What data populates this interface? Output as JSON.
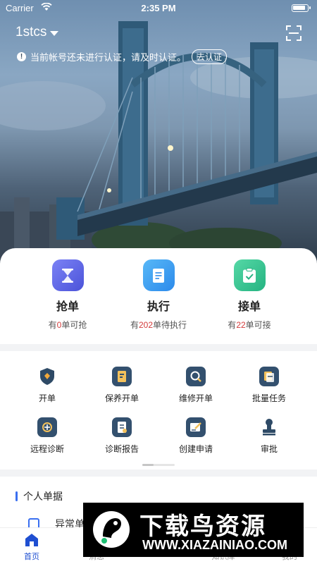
{
  "status_bar": {
    "carrier": "Carrier",
    "time": "2:35 PM"
  },
  "header": {
    "account_name": "1stcs",
    "notice_text": "当前帐号还未进行认证，请及时认证。",
    "notice_action": "去认证"
  },
  "quick_actions": [
    {
      "title": "抢单",
      "prefix": "有",
      "count": "0",
      "suffix": "单可抢",
      "icon": "hourglass-icon"
    },
    {
      "title": "执行",
      "prefix": "有",
      "count": "202",
      "suffix": "单待执行",
      "icon": "document-icon"
    },
    {
      "title": "接单",
      "prefix": "有",
      "count": "22",
      "suffix": "单可接",
      "icon": "clipboard-check-icon"
    }
  ],
  "grid": [
    {
      "label": "开单",
      "icon": "shield-icon"
    },
    {
      "label": "保养开单",
      "icon": "maintenance-doc-icon"
    },
    {
      "label": "维修开单",
      "icon": "repair-search-icon"
    },
    {
      "label": "批量任务",
      "icon": "batch-task-icon"
    },
    {
      "label": "远程诊断",
      "icon": "remote-diagnosis-icon"
    },
    {
      "label": "诊断报告",
      "icon": "report-icon"
    },
    {
      "label": "创建申请",
      "icon": "create-request-icon"
    },
    {
      "label": "审批",
      "icon": "approval-stamp-icon"
    }
  ],
  "personal": {
    "title": "个人单据",
    "row_label": "异常单"
  },
  "tabbar": [
    {
      "label": "首页",
      "active": true
    },
    {
      "label": "消息",
      "active": false
    },
    {
      "label": "知识库",
      "active": false
    },
    {
      "label": "我的",
      "active": false
    }
  ],
  "watermark": {
    "title": "下载鸟资源",
    "url": "WWW.XIAZAINIAO.COM"
  },
  "colors": {
    "accent": "#1f4fd1",
    "count_red": "#d33b3b",
    "section_bar": "#3a6ff0"
  }
}
